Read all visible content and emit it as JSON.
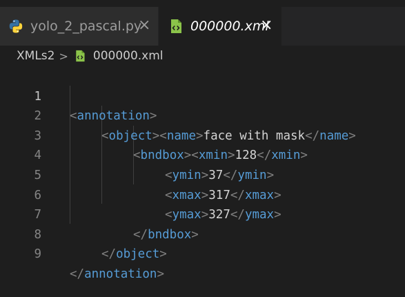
{
  "tabs": [
    {
      "label": "yolo_2_pascal.py",
      "icon": "python-icon",
      "close": "×",
      "active": false
    },
    {
      "label": "000000.xml",
      "icon": "xml-file-icon",
      "close": "×",
      "active": true
    }
  ],
  "breadcrumb": {
    "folder": "XMLs2",
    "separator": ">",
    "file": "000000.xml"
  },
  "editor": {
    "line_numbers": [
      "1",
      "2",
      "3",
      "4",
      "5",
      "6",
      "7",
      "8",
      "9"
    ],
    "tags": {
      "annotation": "annotation",
      "object": "object",
      "name": "name",
      "bndbox": "bndbox",
      "xmin": "xmin",
      "ymin": "ymin",
      "xmax": "xmax",
      "ymax": "ymax"
    },
    "values": {
      "name": "face with mask",
      "xmin": "128",
      "ymin": "37",
      "xmax": "317",
      "ymax": "327"
    }
  },
  "colors": {
    "background": "#1e1e1e",
    "tag": "#569cd6",
    "bracket": "#808080",
    "text": "#d4d4d4",
    "python_blue": "#3572a5",
    "python_yellow": "#ffd43b",
    "xml_green": "#8bc34a"
  }
}
